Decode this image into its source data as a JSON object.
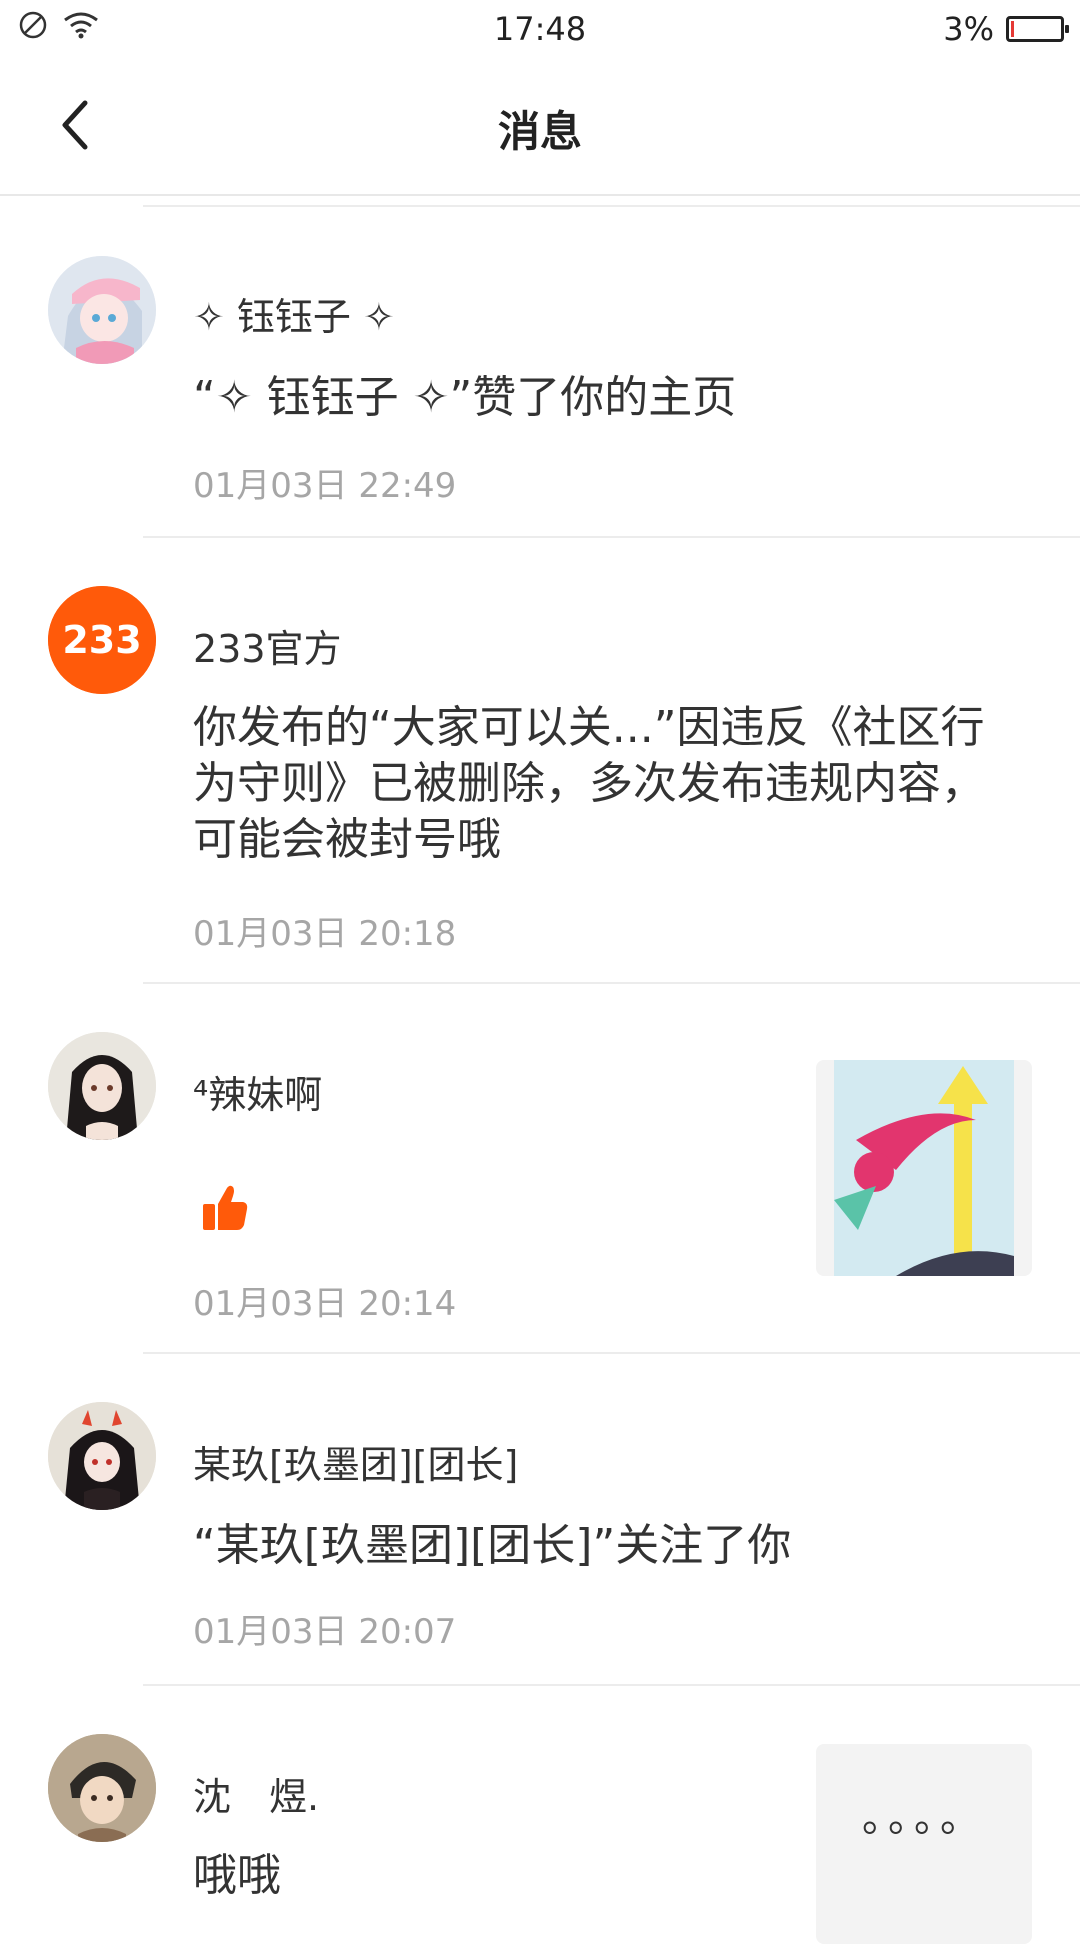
{
  "status_bar": {
    "time": "17:48",
    "battery": "3%"
  },
  "header": {
    "title": "消息"
  },
  "messages": [
    {
      "name": "✧ 钰钰子 ✧",
      "content": "“✧ 钰钰子 ✧”赞了你的主页",
      "time": "01月03日 22:49"
    },
    {
      "name": "233官方",
      "avatar_text": "233",
      "content": "你发布的“大家可以关...”因违反《社区行为守则》已被删除，多次发布违规内容，可能会被封号哦",
      "time": "01月03日 20:18"
    },
    {
      "name": "⁴辣妹啊",
      "content_icon": "thumbs-up-icon",
      "time": "01月03日 20:14"
    },
    {
      "name": "某玖[玖墨团][团长]",
      "content": "“某玖[玖墨团][团长]”关注了你",
      "time": "01月03日 20:07"
    },
    {
      "name": "沈　煜.",
      "content": "哦哦",
      "thumb_text": "。。。。"
    }
  ],
  "colors": {
    "accent": "#ff5a0a",
    "time_text": "#a6a6a6",
    "divider": "#ececec"
  }
}
